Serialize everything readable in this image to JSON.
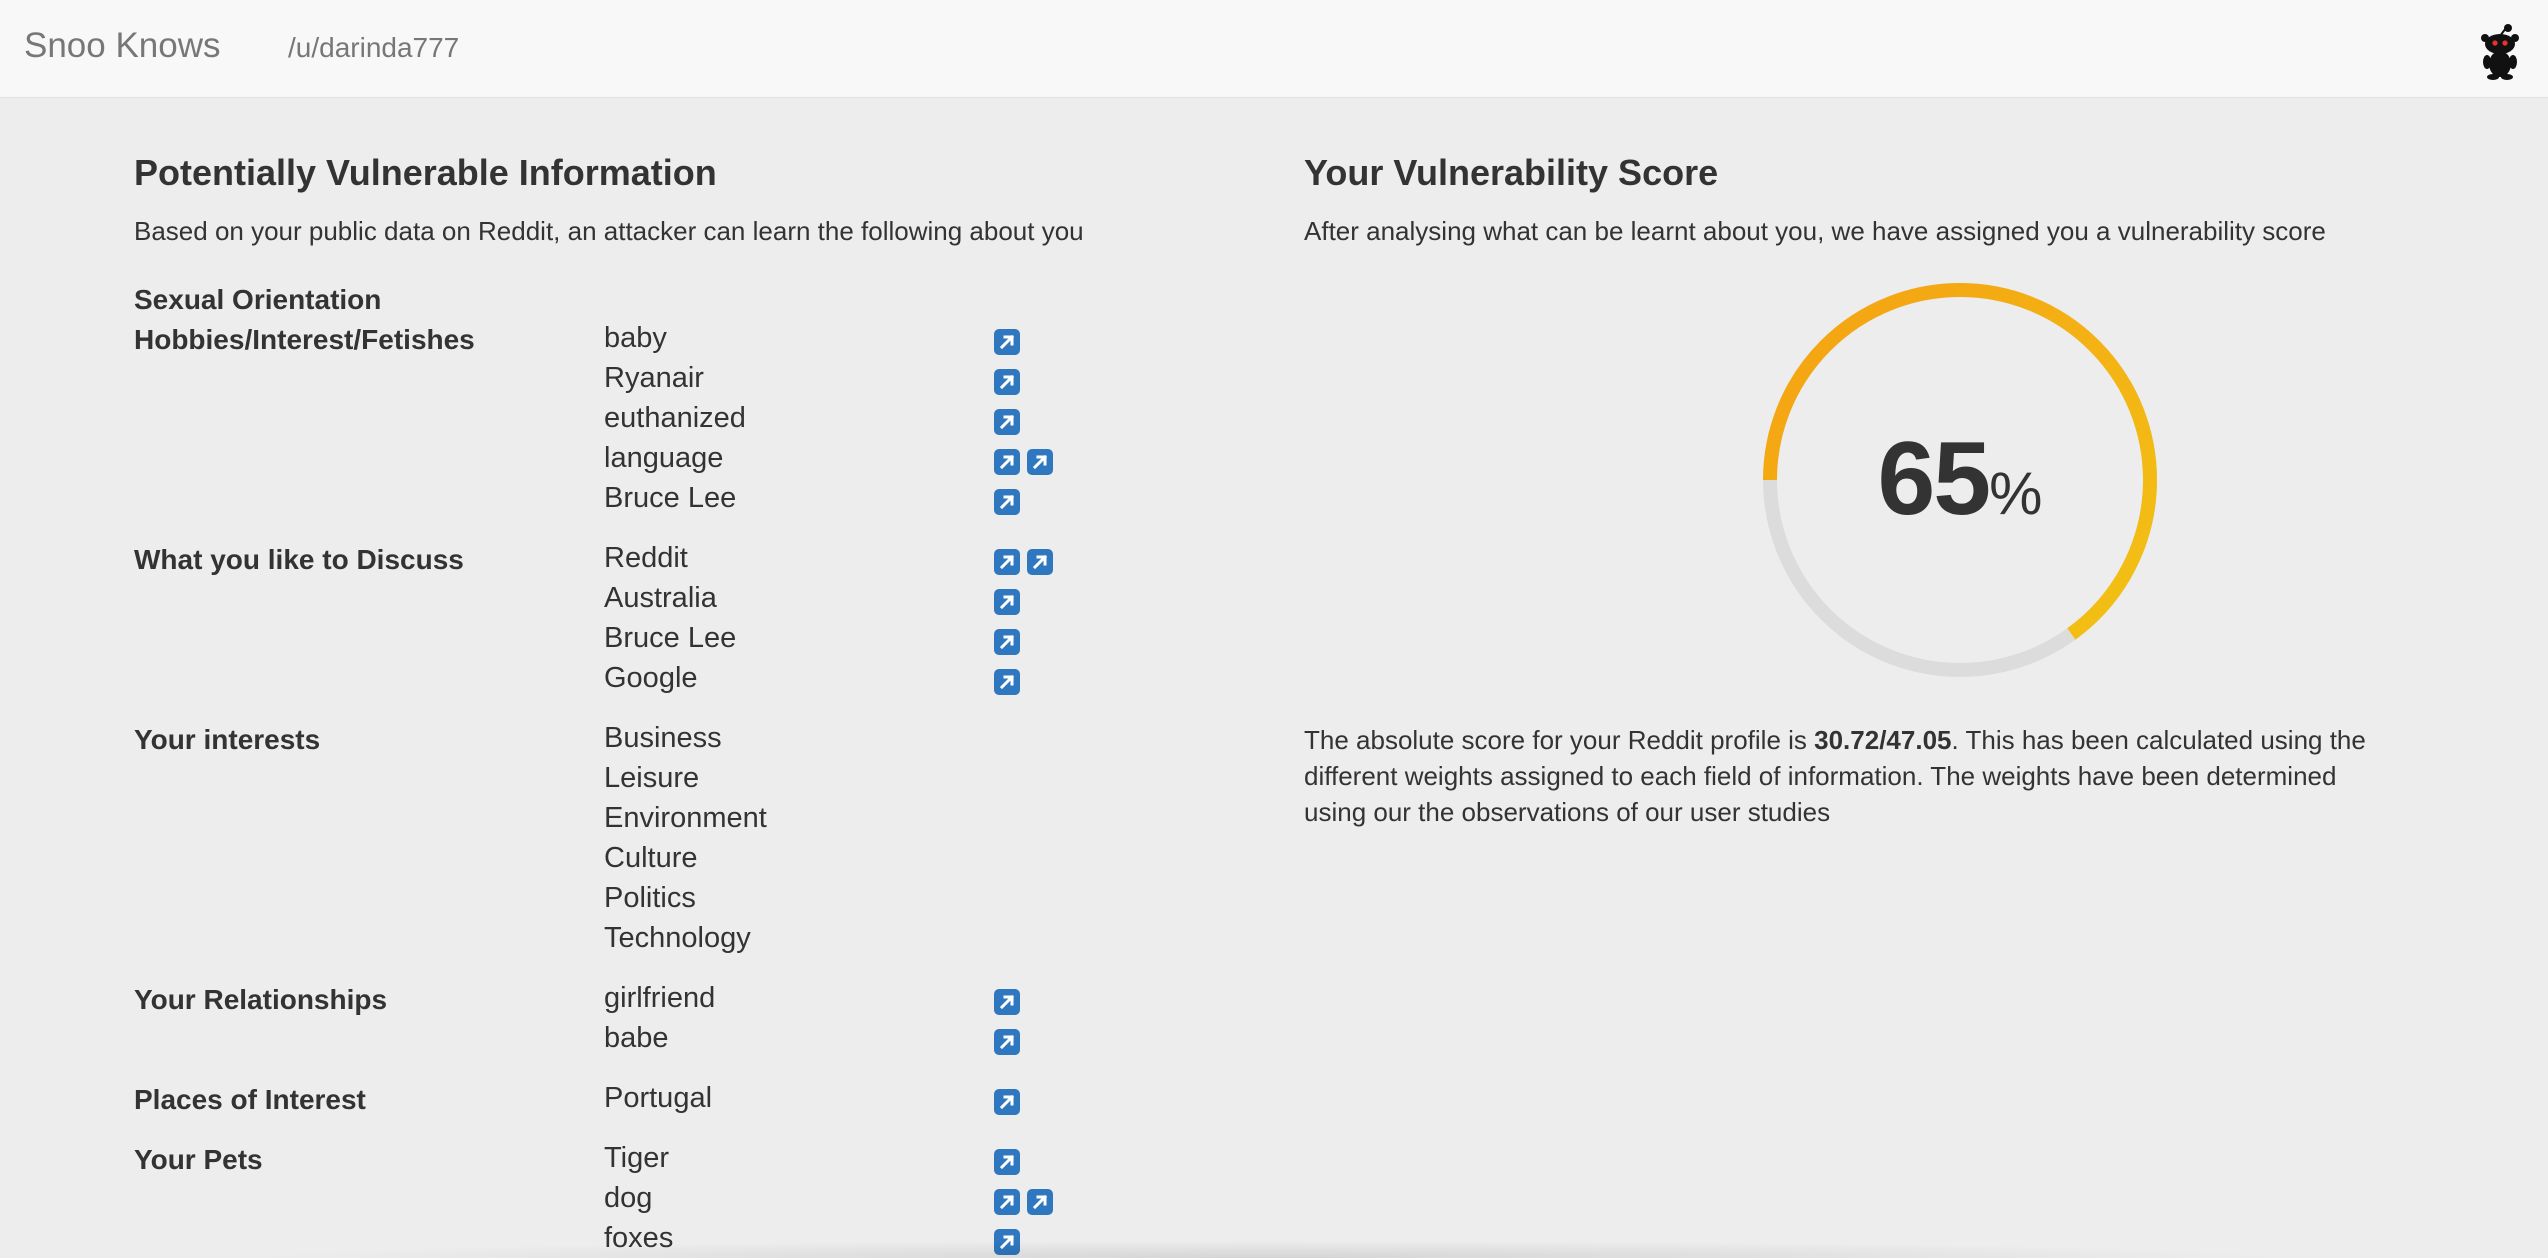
{
  "navbar": {
    "brand": "Snoo Knows",
    "user": "/u/darinda777",
    "logo_icon": "reddit-snoo-icon"
  },
  "left": {
    "title": "Potentially Vulnerable Information",
    "subtitle": "Based on your public data on Reddit, an attacker can learn the following about you",
    "categories": [
      {
        "label": "Sexual Orientation",
        "items": []
      },
      {
        "label": "Hobbies/Interest/Fetishes",
        "items": [
          {
            "text": "baby",
            "links": 1
          },
          {
            "text": "Ryanair",
            "links": 1
          },
          {
            "text": "euthanized",
            "links": 1
          },
          {
            "text": "language",
            "links": 2
          },
          {
            "text": "Bruce Lee",
            "links": 1
          }
        ]
      },
      {
        "label": "What you like to Discuss",
        "items": [
          {
            "text": "Reddit",
            "links": 2
          },
          {
            "text": "Australia",
            "links": 1
          },
          {
            "text": "Bruce Lee",
            "links": 1
          },
          {
            "text": "Google",
            "links": 1
          }
        ]
      },
      {
        "label": "Your interests",
        "items": [
          {
            "text": "Business",
            "links": 0
          },
          {
            "text": "Leisure",
            "links": 0
          },
          {
            "text": "Environment",
            "links": 0
          },
          {
            "text": "Culture",
            "links": 0
          },
          {
            "text": "Politics",
            "links": 0
          },
          {
            "text": "Technology",
            "links": 0
          }
        ]
      },
      {
        "label": "Your Relationships",
        "items": [
          {
            "text": "girlfriend",
            "links": 1
          },
          {
            "text": "babe",
            "links": 1
          }
        ]
      },
      {
        "label": "Places of Interest",
        "items": [
          {
            "text": "Portugal",
            "links": 1
          }
        ]
      },
      {
        "label": "Your Pets",
        "items": [
          {
            "text": "Tiger",
            "links": 1
          },
          {
            "text": "dog",
            "links": 2
          },
          {
            "text": "foxes",
            "links": 1
          }
        ]
      }
    ],
    "link_icon": "external-link-icon"
  },
  "right": {
    "title": "Your Vulnerability Score",
    "subtitle": "After analysing what can be learnt about you, we have assigned you a vulnerability score",
    "score_percent": 65,
    "score_number": "65",
    "score_unit": "%",
    "score_fraction": 0.65,
    "gauge_colors": {
      "start": "#f2c314",
      "end": "#f5a113",
      "track": "#dcdcdc"
    },
    "paragraph_pre": "The absolute score for your Reddit profile is ",
    "absolute_score": "30.72/47.05",
    "paragraph_post": ". This has been calculated using the different weights assigned to each field of information. The weights have been determined using our the observations of our user studies"
  }
}
